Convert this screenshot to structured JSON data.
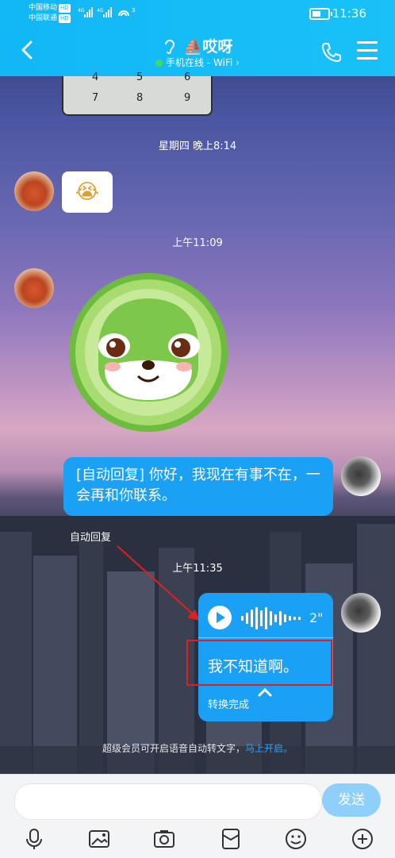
{
  "status_bar": {
    "carrier1": "中国移动",
    "carrier2": "中国联通",
    "hd": "HD",
    "network": "4G",
    "time": "11:36"
  },
  "header": {
    "title": "⛵哎呀",
    "subtitle": "手机在线 - WiFi",
    "subtitle_chevron": "›"
  },
  "keypad_fragment": [
    "4",
    "5",
    "6",
    "7",
    "8",
    "9"
  ],
  "messages": {
    "ts1": "星期四 晚上8:14",
    "emoji": "😭",
    "ts2": "上午11:09",
    "autoreply_text": "[自动回复] 你好，我现在有事不在，一会再和你联系。",
    "annotation_label": "自动回复",
    "ts3": "上午11:35",
    "voice_duration": "2\"",
    "voice_transcript": "我不知道啊。",
    "voice_status": "转换完成"
  },
  "tip": {
    "text": "超级会员可开启语音自动转文字，",
    "link": "马上开启。"
  },
  "input": {
    "placeholder": "",
    "send_label": "发送"
  },
  "colors": {
    "header": "#12b7f5",
    "bubble": "#1aa1f5",
    "send_button": "#8fcffb",
    "annotation": "#e02020",
    "online_dot": "#3ddc5a"
  }
}
